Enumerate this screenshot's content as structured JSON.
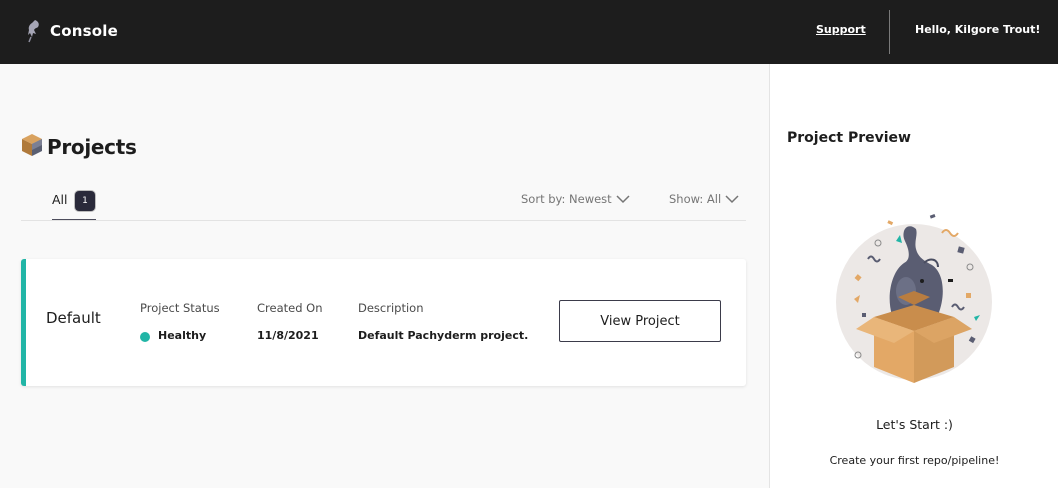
{
  "header": {
    "title": "Console",
    "support_label": "Support",
    "greeting": "Hello, Kilgore Trout!",
    "logo_icon": "pachyderm-logo-icon"
  },
  "main": {
    "title": "Projects",
    "title_icon": "projects-cube-icon",
    "tabs": [
      {
        "label": "All",
        "count": "1",
        "active": true
      }
    ],
    "sort_label": "Sort by: Newest",
    "show_label": "Show: All",
    "projects": [
      {
        "name": "Default",
        "status_label": "Project Status",
        "status_value": "Healthy",
        "status_color": "#21b5a6",
        "created_label": "Created On",
        "created_value": "11/8/2021",
        "description_label": "Description",
        "description_value": "Default Pachyderm project.",
        "action_label": "View Project"
      }
    ]
  },
  "preview": {
    "title": "Project Preview",
    "illustration": "elephant-in-box-confetti-icon",
    "heading": "Let's Start :)",
    "subtext": "Create your first repo/pipeline!"
  },
  "colors": {
    "topbar": "#1d1d1d",
    "accent": "#21b5a6",
    "background": "#f9f9f9"
  }
}
